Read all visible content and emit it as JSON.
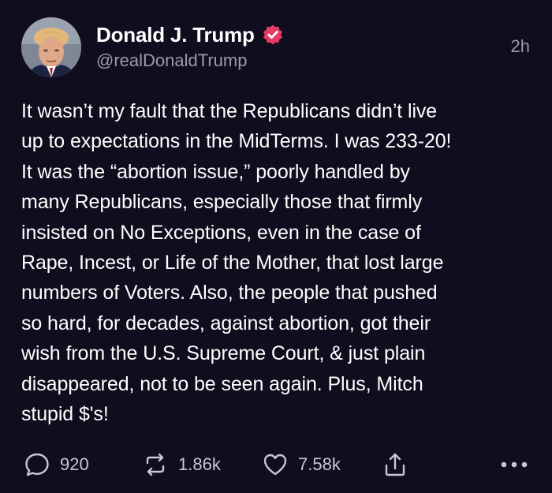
{
  "author": {
    "display_name": "Donald J. Trump",
    "handle": "@realDonaldTrump",
    "verified_icon": "verified-badge-icon",
    "badge_color": "#e63b63"
  },
  "timestamp": "2h",
  "post": {
    "lines": [
      "It wasn’t my fault that the Republicans didn’t live",
      "up to expectations in the MidTerms. I was 233-20!",
      "It was the “abortion issue,” poorly handled by",
      "many Republicans, especially those that firmly",
      "insisted on No Exceptions, even in the case of",
      "Rape, Incest, or Life of the Mother, that lost large",
      "numbers of Voters. Also, the people that pushed",
      "so hard, for decades, against abortion, got their",
      "wish from the U.S. Supreme Court, & just plain",
      "disappeared, not to be seen again. Plus, Mitch",
      "stupid $'s!"
    ]
  },
  "actions": {
    "replies": "920",
    "reposts": "1.86k",
    "likes": "7.58k",
    "icons": [
      "reply-icon",
      "repost-icon",
      "like-icon",
      "share-icon",
      "more-icon"
    ]
  },
  "colors": {
    "background": "#0f0d1e",
    "text": "#ffffff",
    "secondary_text": "#9d9aae"
  }
}
